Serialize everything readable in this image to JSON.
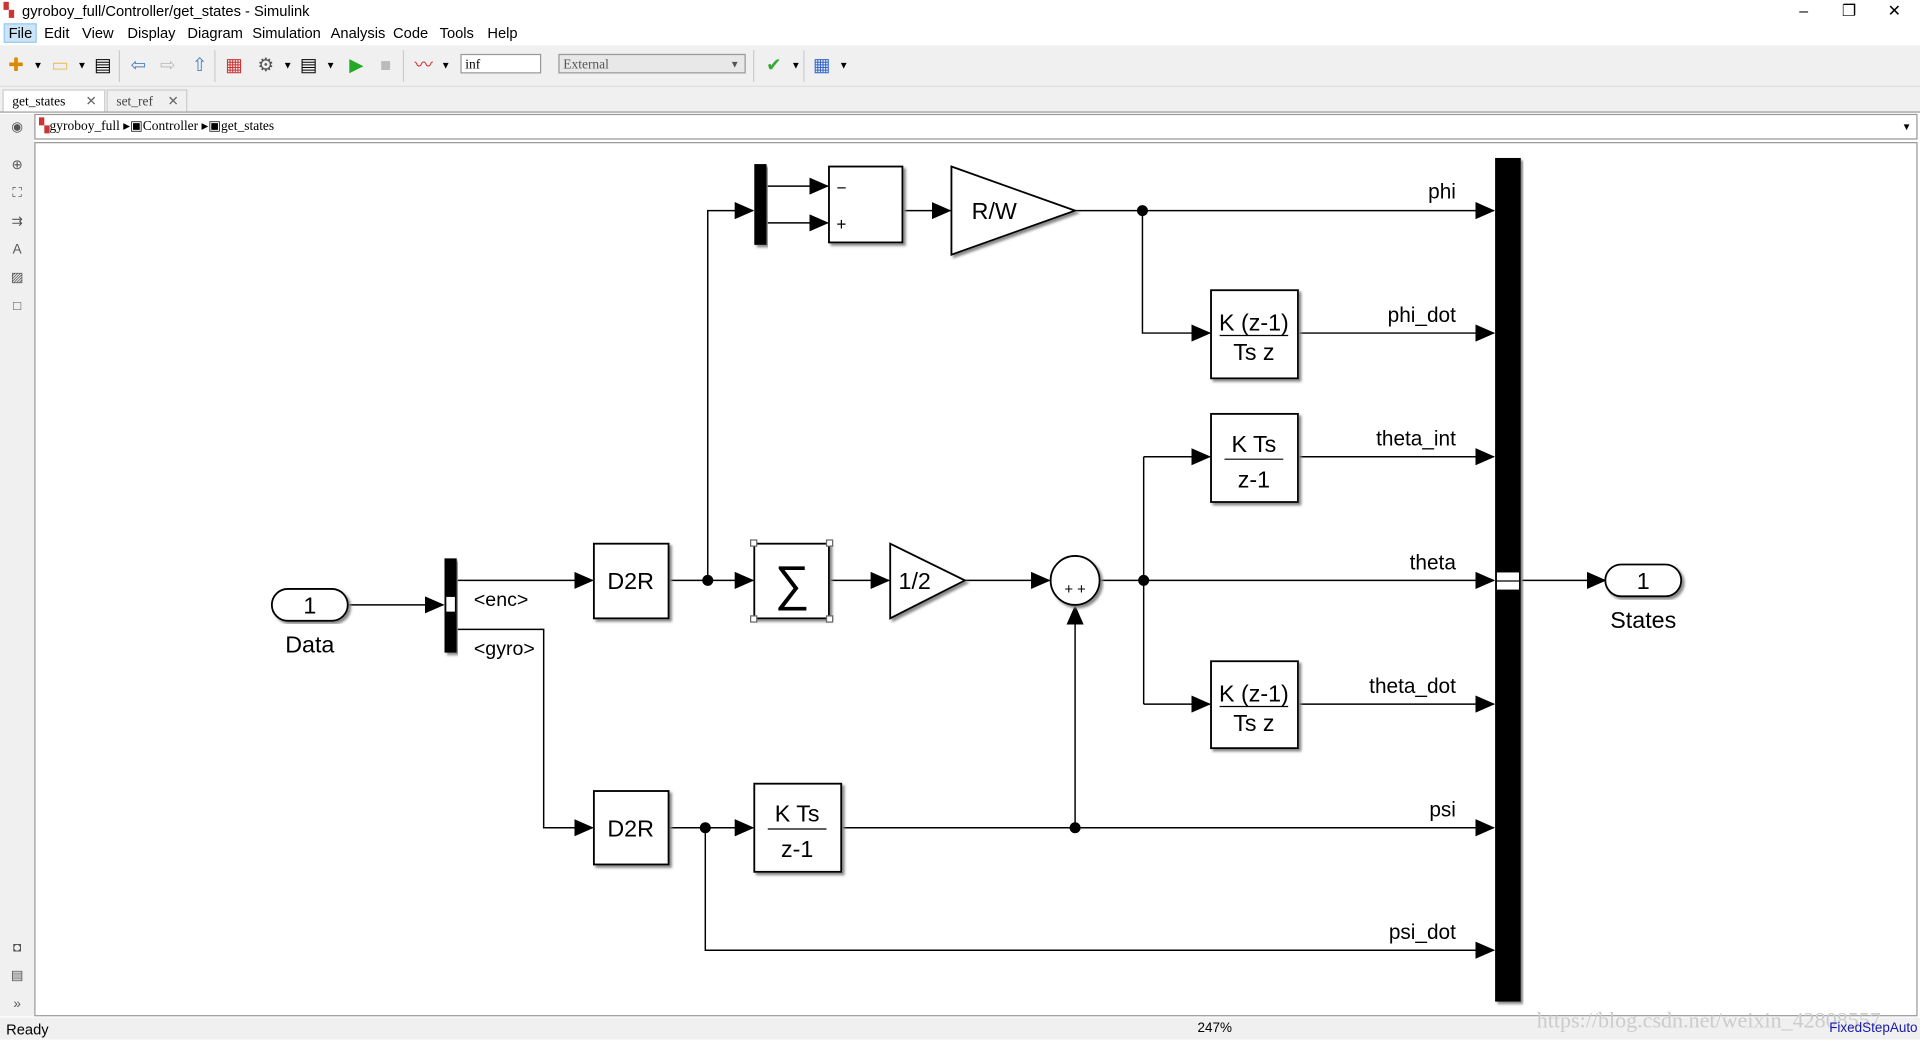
{
  "window": {
    "title": "gyroboy_full/Controller/get_states - Simulink",
    "controls": [
      "minimize",
      "restore",
      "close"
    ]
  },
  "menu": [
    "File",
    "Edit",
    "View",
    "Display",
    "Diagram",
    "Simulation",
    "Analysis",
    "Code",
    "Tools",
    "Help"
  ],
  "toolbar": {
    "stop_time": "inf",
    "sim_mode": "External"
  },
  "tabs": [
    {
      "label": "get_states",
      "active": true
    },
    {
      "label": "set_ref",
      "active": false
    }
  ],
  "breadcrumb": [
    "gyroboy_full",
    "Controller",
    "get_states"
  ],
  "diagram": {
    "inport": {
      "number": "1",
      "label": "Data"
    },
    "outport": {
      "number": "1",
      "label": "States"
    },
    "bus_signals": [
      "<enc>",
      "<gyro>"
    ],
    "d2r": "D2R",
    "sum_signs": [
      "−",
      "+"
    ],
    "gain_rw": "R/W",
    "gain_half": "1/2",
    "sigma": "∑",
    "deriv_num": "K (z-1)",
    "deriv_den": "Ts z",
    "integ_num": "K Ts",
    "integ_den": "z-1",
    "circle_signs": "+ +",
    "signals": [
      "phi",
      "phi_dot",
      "theta_int",
      "theta",
      "theta_dot",
      "psi",
      "psi_dot"
    ]
  },
  "status": {
    "left": "Ready",
    "zoom": "247%",
    "solver": "FixedStepAuto",
    "watermark": "https://blog.csdn.net/weixin_42808557"
  }
}
